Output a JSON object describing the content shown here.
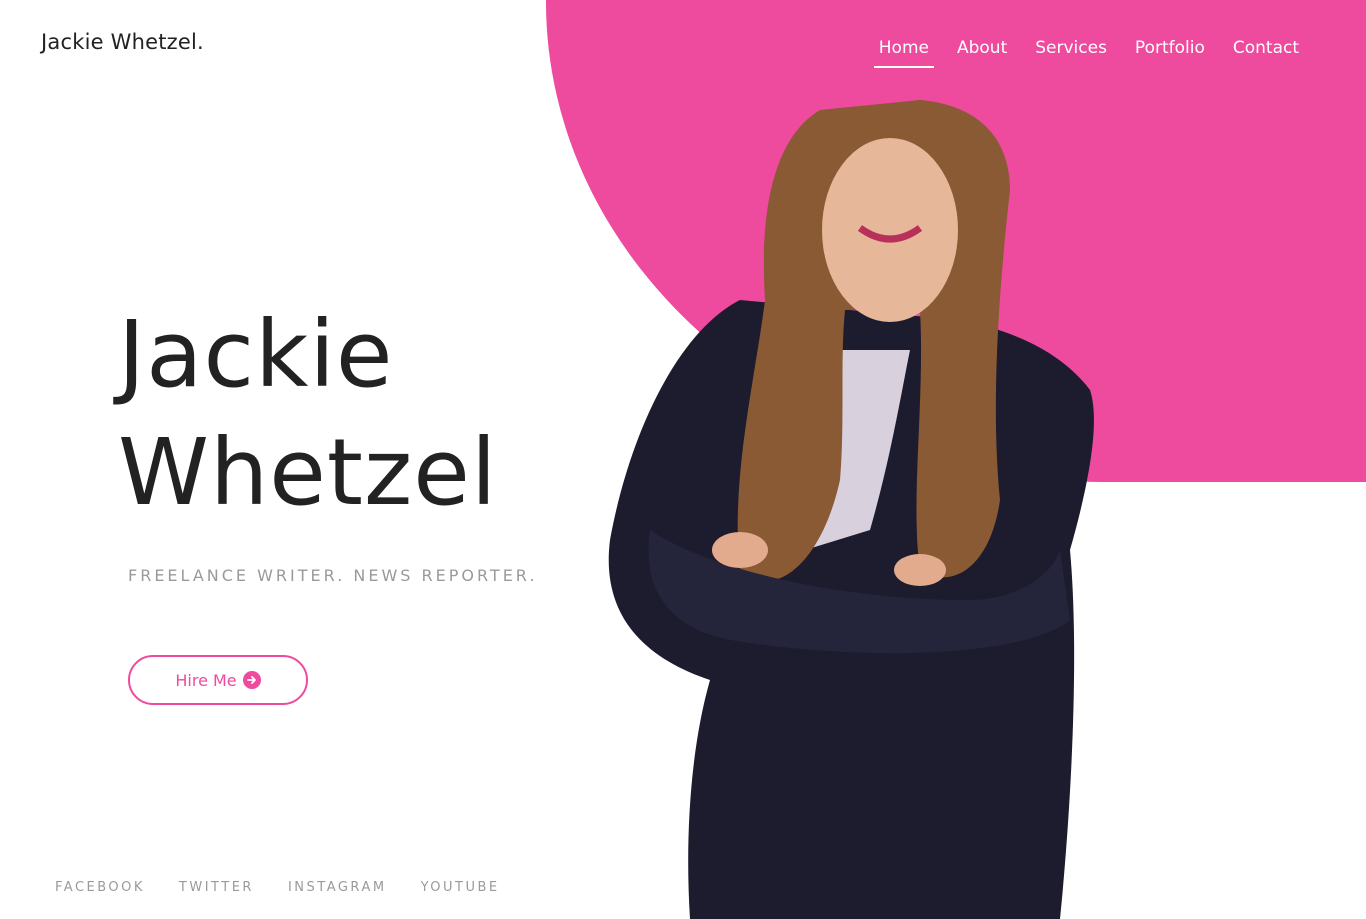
{
  "brand": {
    "name": "Jackie Whetzel."
  },
  "nav": {
    "items": [
      {
        "label": "Home",
        "active": true
      },
      {
        "label": "About"
      },
      {
        "label": "Services"
      },
      {
        "label": "Portfolio"
      },
      {
        "label": "Contact"
      }
    ]
  },
  "hero": {
    "first_name": "Jackie",
    "last_name": "Whetzel",
    "tagline": "FREELANCE WRITER. NEWS REPORTER.",
    "cta_label": "Hire Me",
    "cta_icon": "arrow-right-circle-icon"
  },
  "social": [
    "FACEBOOK",
    "TWITTER",
    "INSTAGRAM",
    "YOUTUBE"
  ],
  "colors": {
    "accent": "#ee4a9e",
    "text": "#222222",
    "muted": "#9a9a9a"
  }
}
